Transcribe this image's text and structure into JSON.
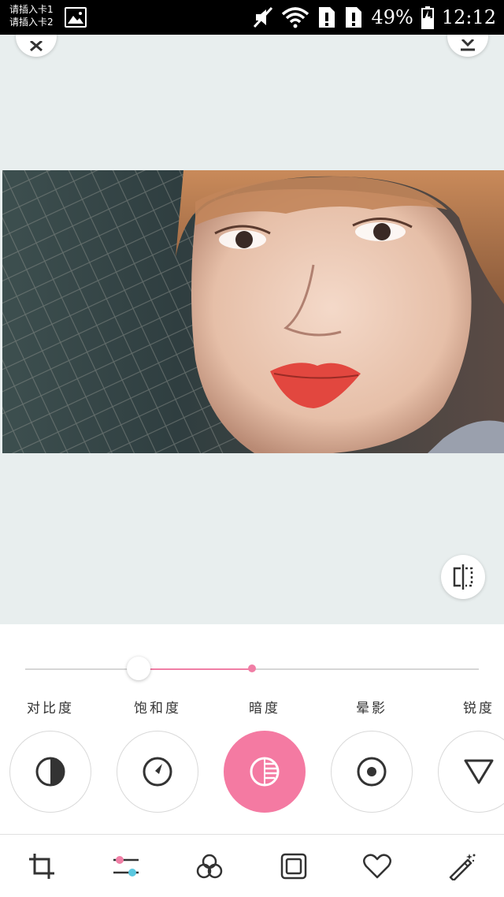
{
  "status_bar": {
    "sim1": "请插入卡1",
    "sim2": "请插入卡2",
    "battery": "49%",
    "time": "12:12"
  },
  "slider": {
    "value_fraction": 0.25,
    "neutral_fraction": 0.5,
    "accent_color": "#f07ea5"
  },
  "tools": [
    {
      "label": "对比度",
      "icon": "contrast-icon",
      "active": false
    },
    {
      "label": "饱和度",
      "icon": "saturation-gauge-icon",
      "active": false
    },
    {
      "label": "暗度",
      "icon": "shadow-icon",
      "active": true
    },
    {
      "label": "晕影",
      "icon": "vignette-icon",
      "active": false
    },
    {
      "label": "锐度",
      "icon": "sharpen-triangle-icon",
      "active": false
    }
  ],
  "bottom_nav": [
    {
      "icon": "crop-icon"
    },
    {
      "icon": "adjust-sliders-icon",
      "active": true
    },
    {
      "icon": "filters-icon"
    },
    {
      "icon": "frame-icon"
    },
    {
      "icon": "heart-icon"
    },
    {
      "icon": "magic-wand-icon"
    }
  ],
  "colors": {
    "accent": "#f47aa2",
    "canvas_bg": "#e8eeee"
  }
}
